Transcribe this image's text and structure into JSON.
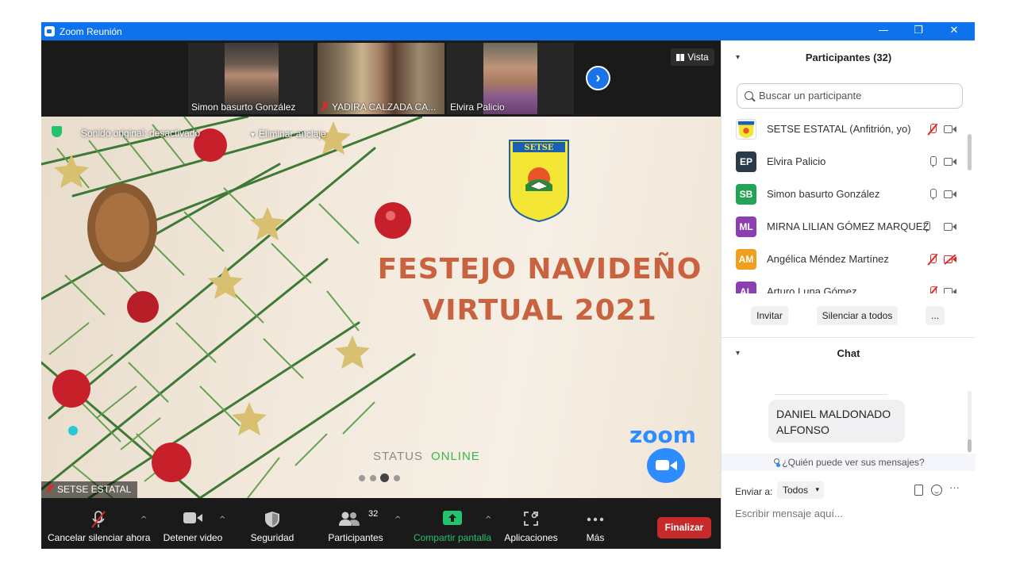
{
  "window": {
    "title": "Zoom Reunión",
    "minimize": "—",
    "restore": "❐",
    "close": "✕"
  },
  "thumbnails": [
    {
      "name": "Simon basurto González",
      "muted": false
    },
    {
      "name": "YADIRA CALZADA CA...",
      "muted": true
    },
    {
      "name": "Elvira Palicio",
      "muted": false
    }
  ],
  "view_button": "Vista",
  "share_bar": {
    "sound": "Sonido original: desactivado",
    "unpin": "Eliminar anclaje"
  },
  "slide": {
    "title_line1": "FESTEJO NAVIDEÑO",
    "title_line2": "VIRTUAL 2021",
    "status_label": "STATUS",
    "status_value": "ONLINE",
    "zoom_logo": "zoom",
    "logo_text": "SETSE"
  },
  "presenter_label": "SETSE ESTATAL",
  "toolbar": {
    "mute": "Cancelar silenciar ahora",
    "video": "Detener video",
    "security": "Seguridad",
    "participants": "Participantes",
    "participants_count": "32",
    "share": "Compartir pantalla",
    "apps": "Aplicaciones",
    "more": "Más",
    "end": "Finalizar"
  },
  "participants_panel": {
    "title": "Participantes (32)",
    "search_placeholder": "Buscar un participante",
    "items": [
      {
        "initials": "",
        "name": "SETSE ESTATAL (Anfitrión, yo)",
        "color": "#ffffff",
        "mic": "off",
        "cam": "on"
      },
      {
        "initials": "EP",
        "name": "Elvira Palicio",
        "color": "#2b3a4a",
        "mic": "on",
        "cam": "on"
      },
      {
        "initials": "SB",
        "name": "Simon basurto González",
        "color": "#23a455",
        "mic": "on",
        "cam": "on"
      },
      {
        "initials": "ML",
        "name": "MIRNA LILIAN GÓMEZ MARQUEZ",
        "color": "#8b3fb0",
        "mic": "on",
        "cam": "on"
      },
      {
        "initials": "AM",
        "name": "Angélica Méndez Martínez",
        "color": "#f0a01e",
        "mic": "off",
        "cam": "off"
      },
      {
        "initials": "AL",
        "name": "Arturo Luna Gómez",
        "color": "#8b3fb0",
        "mic": "off",
        "cam": "on"
      }
    ],
    "invite": "Invitar",
    "mute_all": "Silenciar a todos",
    "more": "..."
  },
  "chat_panel": {
    "title": "Chat",
    "message": "DANIEL MALDONADO ALFONSO",
    "who_can_see": "¿Quién puede ver sus mensajes?",
    "send_to_label": "Enviar a:",
    "send_to_value": "Todos",
    "input_placeholder": "Escribir mensaje aquí...",
    "more": "···"
  }
}
